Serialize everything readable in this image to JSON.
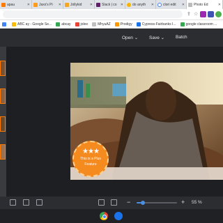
{
  "browser": {
    "tabs": [
      {
        "label": "apau",
        "color": "#ff7a00"
      },
      {
        "label": "Jaxx's Pi",
        "color": "#ff9b1a"
      },
      {
        "label": "Jollykid",
        "color": "#f6a623"
      },
      {
        "label": "Slack | co",
        "color": "#611f69"
      },
      {
        "label": "do anyth",
        "color": "#f8b400"
      },
      {
        "label": "clori edit",
        "color": "#4285f4"
      },
      {
        "label": "Photo Ed",
        "color": "#ffffff",
        "active": true
      }
    ],
    "bookmarks": [
      {
        "label": "Apps",
        "color": "#4285f4"
      },
      {
        "label": "ABC ay - Google Se...",
        "color": "#fbbc05"
      },
      {
        "label": "abcay",
        "color": "#34a853"
      },
      {
        "label": "jolee",
        "color": "#ea4335"
      },
      {
        "label": "MhyuAZ",
        "color": "#c0c0c0"
      },
      {
        "label": "Prodigy",
        "color": "#ff9800"
      },
      {
        "label": "Cypress-Fairbanks I...",
        "color": "#1a73e8"
      },
      {
        "label": "google classroom ...",
        "color": "#34a853"
      }
    ]
  },
  "editor": {
    "menu": {
      "open": "Open ⌄",
      "save": "Save ⌄",
      "batch": "Batch"
    },
    "plus_badge": {
      "line1": "This is a Plus",
      "line2": "Feature"
    },
    "zoom": {
      "minus": "−",
      "plus": "+",
      "value": "55 %",
      "fraction": 0.55
    }
  },
  "colors": {
    "accent": "#ff7a00",
    "blue": "#4a90e2"
  }
}
